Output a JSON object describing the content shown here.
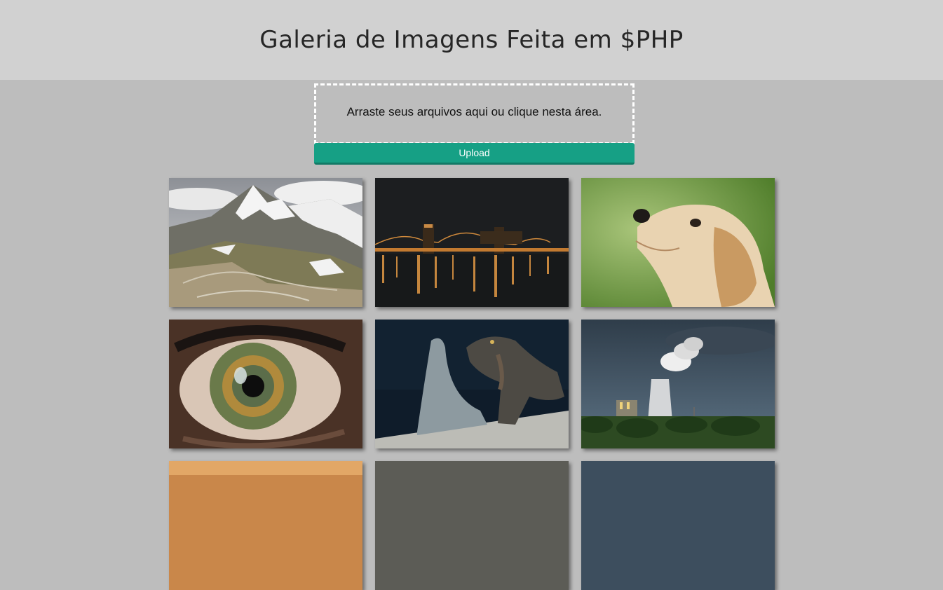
{
  "header": {
    "title": "Galeria de Imagens Feita em $PHP"
  },
  "upload": {
    "dropzone_text": "Arraste seus arquivos aqui ou clique nesta área.",
    "button_label": "Upload"
  },
  "gallery": {
    "images": [
      {
        "subject": "snowy-mountain-road"
      },
      {
        "subject": "night-bridge-river"
      },
      {
        "subject": "golden-retriever-puppy"
      },
      {
        "subject": "human-eye-closeup"
      },
      {
        "subject": "iguanas"
      },
      {
        "subject": "power-plant-cooling-tower"
      },
      {
        "subject": "partial-warm"
      },
      {
        "subject": "partial-grey"
      },
      {
        "subject": "partial-blue"
      }
    ]
  },
  "colors": {
    "header_bg": "#d1d1d1",
    "page_bg": "#bdbdbd",
    "button_bg": "#16a085"
  }
}
